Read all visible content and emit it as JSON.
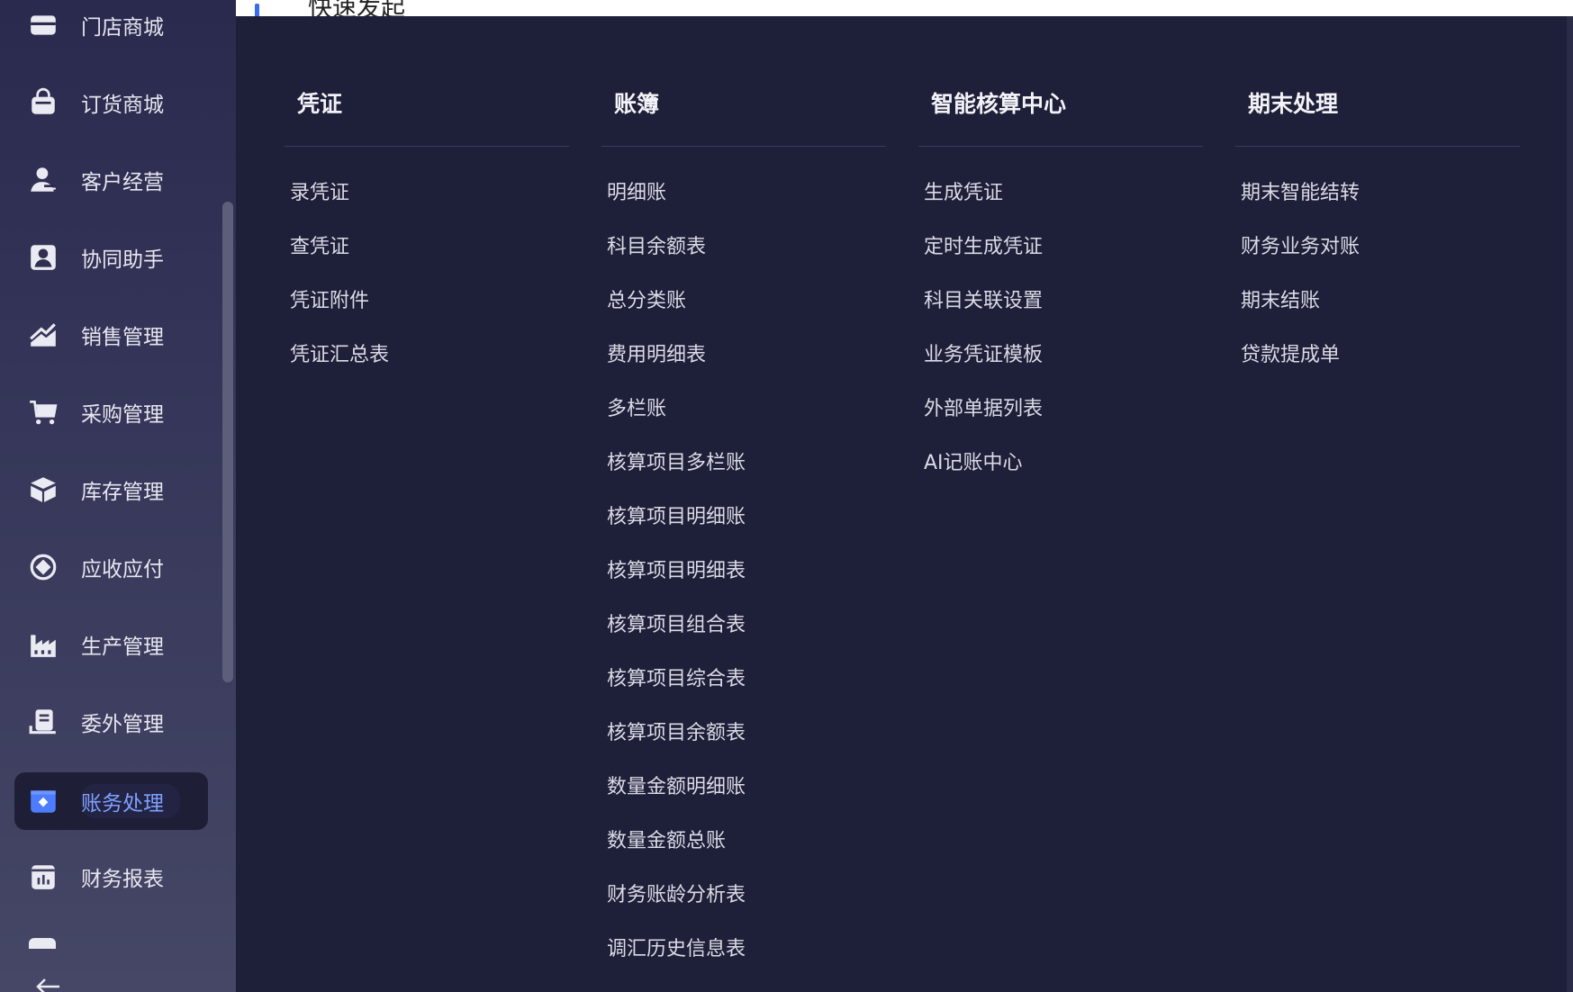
{
  "header": {
    "title": "快速发起"
  },
  "sidebar": {
    "items": [
      {
        "label": "门店商城",
        "icon": "store-icon"
      },
      {
        "label": "订货商城",
        "icon": "shopping-bag-icon"
      },
      {
        "label": "客户经营",
        "icon": "customer-icon"
      },
      {
        "label": "协同助手",
        "icon": "contact-card-icon"
      },
      {
        "label": "销售管理",
        "icon": "sales-chart-icon"
      },
      {
        "label": "采购管理",
        "icon": "cart-icon"
      },
      {
        "label": "库存管理",
        "icon": "box-icon"
      },
      {
        "label": "应收应付",
        "icon": "receivable-icon"
      },
      {
        "label": "生产管理",
        "icon": "factory-icon"
      },
      {
        "label": "委外管理",
        "icon": "outsource-icon"
      },
      {
        "label": "账务处理",
        "icon": "ledger-icon",
        "active": true
      },
      {
        "label": "财务报表",
        "icon": "report-icon"
      }
    ]
  },
  "menu": {
    "columns": [
      {
        "title": "凭证",
        "items": [
          "录凭证",
          "查凭证",
          "凭证附件",
          "凭证汇总表"
        ]
      },
      {
        "title": "账簿",
        "items": [
          "明细账",
          "科目余额表",
          "总分类账",
          "费用明细表",
          "多栏账",
          "核算项目多栏账",
          "核算项目明细账",
          "核算项目明细表",
          "核算项目组合表",
          "核算项目综合表",
          "核算项目余额表",
          "数量金额明细账",
          "数量金额总账",
          "财务账龄分析表",
          "调汇历史信息表"
        ]
      },
      {
        "title": "智能核算中心",
        "items": [
          "生成凭证",
          "定时生成凭证",
          "科目关联设置",
          "业务凭证模板",
          "外部单据列表",
          "AI记账中心"
        ]
      },
      {
        "title": "期末处理",
        "items": [
          "期末智能结转",
          "财务业务对账",
          "期末结账",
          "贷款提成单"
        ]
      }
    ]
  },
  "colors": {
    "sidebar_bg": "#2a2a4e",
    "menu_bg": "#1e1f38",
    "active_text": "#7ea0ff",
    "active_icon": "#4d7cff",
    "accent": "#3a6cf0"
  }
}
